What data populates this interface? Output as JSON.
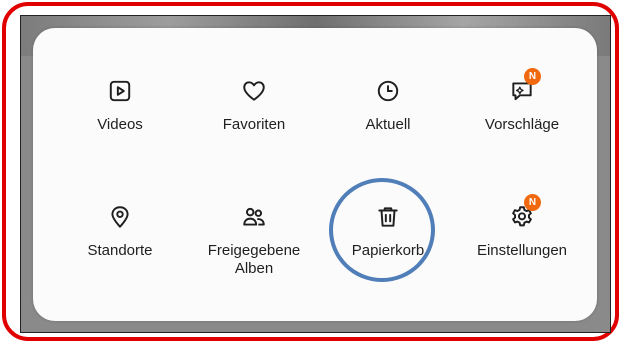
{
  "menu": {
    "items": [
      {
        "label": "Videos",
        "icon": "play-square-icon"
      },
      {
        "label": "Favoriten",
        "icon": "heart-icon"
      },
      {
        "label": "Aktuell",
        "icon": "clock-icon"
      },
      {
        "label": "Vorschläge",
        "icon": "sparkle-chat-icon",
        "badge": "N"
      },
      {
        "label": "Standorte",
        "icon": "location-pin-icon"
      },
      {
        "label": "Freigegebene Alben",
        "icon": "people-icon"
      },
      {
        "label": "Papierkorb",
        "icon": "trash-icon"
      },
      {
        "label": "Einstellungen",
        "icon": "gear-icon",
        "badge": "N"
      }
    ]
  },
  "colors": {
    "frame": "#e00000",
    "highlight": "#4f7eb8",
    "badge": "#f1690e"
  }
}
